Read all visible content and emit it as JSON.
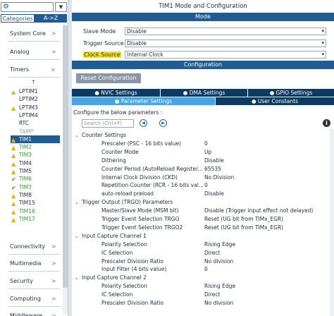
{
  "left": {
    "tabs": {
      "categories": "Categories",
      "az": "A->Z"
    },
    "dropdown_icon": "chevron-down-icon",
    "categories": [
      {
        "label": "System Core",
        "arrow": ">"
      },
      {
        "label": "Analog",
        "arrow": ">"
      },
      {
        "label": "Timers",
        "arrow": "v"
      }
    ],
    "up_arrow": "↑",
    "peripherals": [
      {
        "label": "LPTIM1",
        "status": "warning"
      },
      {
        "label": "LPTIM2",
        "status": "none"
      },
      {
        "label": "LPTIM3",
        "status": "warning"
      },
      {
        "label": "LPTIM4",
        "status": "none"
      },
      {
        "label": "RTC",
        "status": "none"
      },
      {
        "label": "TAMP",
        "status": "disabled"
      },
      {
        "label": "TIM1",
        "status": "warning",
        "selected": true
      },
      {
        "label": "TIM2",
        "status": "warning-green"
      },
      {
        "label": "TIM3",
        "status": "warning-green"
      },
      {
        "label": "TIM4",
        "status": "warning"
      },
      {
        "label": "TIM5",
        "status": "warning"
      },
      {
        "label": "TIM6",
        "status": "check"
      },
      {
        "label": "TIM7",
        "status": "check"
      },
      {
        "label": "TIM8",
        "status": "warning"
      },
      {
        "label": "TIM15",
        "status": "warning"
      },
      {
        "label": "TIM16",
        "status": "warning-green"
      },
      {
        "label": "TIM17",
        "status": "warning-green"
      }
    ],
    "categories_bottom": [
      {
        "label": "Connectivity",
        "arrow": ">"
      },
      {
        "label": "Multimedia",
        "arrow": ">"
      },
      {
        "label": "Security",
        "arrow": ">"
      },
      {
        "label": "Computing",
        "arrow": ">"
      },
      {
        "label": "Middleware",
        "arrow": ">"
      }
    ]
  },
  "title": "TIM1 Mode and Configuration",
  "mode_header": "Mode",
  "mode": {
    "slave_mode": {
      "label": "Slave Mode",
      "value": "Disable"
    },
    "trigger_source": {
      "label": "Trigger Source",
      "value": "Disable"
    },
    "clock_source": {
      "label": "Clock Source",
      "value": "Internal Clock"
    }
  },
  "config_header": "Configuration",
  "reset_button": "Reset Configuration",
  "tabs_row1": [
    "NVIC Settings",
    "DMA Settings",
    "GPIO Settings"
  ],
  "tabs_row2": [
    "Parameter Settings",
    "User Constants"
  ],
  "configure_text": "Configure the below parameters :",
  "search_placeholder": "Search (Ctrl+F)",
  "tree": [
    {
      "group": "Counter Settings"
    },
    {
      "label": "Prescaler (PSC - 16 bits value)",
      "value": "0"
    },
    {
      "label": "Counter Mode",
      "value": "Up"
    },
    {
      "label": "Dithering",
      "value": "Disable"
    },
    {
      "label": "Counter Period (AutoReload Register...",
      "value": "65535"
    },
    {
      "label": "Internal Clock Division (CKD)",
      "value": "No Division"
    },
    {
      "label": "Repetition Counter (RCR - 16 bits val...",
      "value": "0"
    },
    {
      "label": "auto-reload preload",
      "value": "Disable"
    },
    {
      "group": "Trigger Output (TRGO) Parameters"
    },
    {
      "label": "Master/Slave Mode (MSM bit)",
      "value": "Disable (Trigger input effect not delayed)"
    },
    {
      "label": "Trigger Event Selection TRGO",
      "value": "Reset (UG bit from TIMx_EGR)"
    },
    {
      "label": "Trigger Event Selection TRGO2",
      "value": "Reset (UG bit from TIMx_EGR)"
    },
    {
      "group": "Input Capture Channel 1"
    },
    {
      "label": "Polarity Selection",
      "value": "Rising Edge"
    },
    {
      "label": "IC Selection",
      "value": "Direct"
    },
    {
      "label": "Prescaler Division Ratio",
      "value": "No division"
    },
    {
      "label": "Input Filter (4 bits value)",
      "value": "0"
    },
    {
      "group": "Input Capture Channel 2"
    },
    {
      "label": "Polarity Selection",
      "value": "Rising Edge"
    },
    {
      "label": "IC Selection",
      "value": "Direct"
    },
    {
      "label": "Prescaler Division Ratio",
      "value": "No division"
    }
  ],
  "colors": {
    "header_blue": "#1f5c93",
    "tab_dark": "#0d3a63",
    "tab_active": "#4aa3e6",
    "highlight": "#f7e400"
  }
}
